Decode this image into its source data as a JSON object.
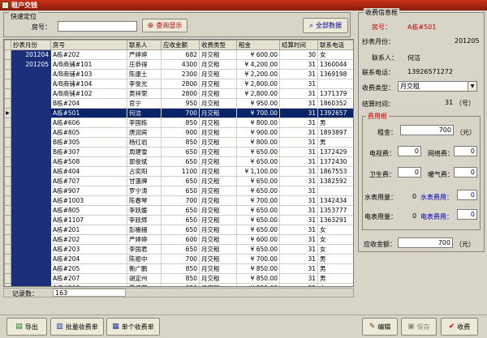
{
  "window": {
    "title": "租户交钱"
  },
  "quick_search": {
    "legend": "快速定位",
    "room_label": "房号：",
    "room_value": "",
    "query_button": "查询显示",
    "all_button": "全部数据"
  },
  "table": {
    "columns": [
      "抄表月份",
      "房号",
      "联系人",
      "应收金额",
      "收费类型",
      "租金",
      "结算时间",
      "联系电话"
    ],
    "month_1": "201204",
    "month_2": "201205",
    "rows": [
      {
        "room": "A栋#202",
        "contact": "严婷婷",
        "amount": "682",
        "type": "月交租",
        "rent": "¥ 600.00",
        "settle": "30",
        "phone": "女"
      },
      {
        "room": "A/B商铺#101",
        "contact": "庄恭得",
        "amount": "4300",
        "type": "月交租",
        "rent": "¥ 4,200.00",
        "settle": "31",
        "phone": "1360044"
      },
      {
        "room": "A/B商铺#103",
        "contact": "陈康土",
        "amount": "2300",
        "type": "月交租",
        "rent": "¥ 2,200.00",
        "settle": "31",
        "phone": "1369198"
      },
      {
        "room": "A/B商铺#104",
        "contact": "李俊光",
        "amount": "2800",
        "type": "月交租",
        "rent": "¥ 2,800.00",
        "settle": "31",
        "phone": ""
      },
      {
        "room": "A/B商铺#102",
        "contact": "黄祥荣",
        "amount": "2800",
        "type": "月交租",
        "rent": "¥ 2,800.00",
        "settle": "31",
        "phone": "1371379"
      },
      {
        "room": "B栋#204",
        "contact": "官宁",
        "amount": "950",
        "type": "月交租",
        "rent": "¥ 950.00",
        "settle": "31",
        "phone": "1860352"
      },
      {
        "room": "A栋#501",
        "contact": "何洁",
        "amount": "700",
        "type": "月交租",
        "rent": "¥ 700.00",
        "settle": "31",
        "phone": "1392657"
      },
      {
        "room": "A栋#606",
        "contact": "李国栋",
        "amount": "850",
        "type": "月交租",
        "rent": "¥ 800.00",
        "settle": "31",
        "phone": "男"
      },
      {
        "room": "A栋#805",
        "contact": "唐润宾",
        "amount": "900",
        "type": "月交租",
        "rent": "¥ 900.00",
        "settle": "31",
        "phone": "1893897"
      },
      {
        "room": "B栋#305",
        "contact": "杨红岩",
        "amount": "850",
        "type": "月交租",
        "rent": "¥ 800.00",
        "settle": "31",
        "phone": "男"
      },
      {
        "room": "B栋#307",
        "contact": "周建雪",
        "amount": "650",
        "type": "月交租",
        "rent": "¥ 650.00",
        "settle": "31",
        "phone": "1372429"
      },
      {
        "room": "A栋#508",
        "contact": "郭俊斌",
        "amount": "650",
        "type": "月交租",
        "rent": "¥ 650.00",
        "settle": "31",
        "phone": "1372430"
      },
      {
        "room": "A栋#404",
        "contact": "占奕阳",
        "amount": "1100",
        "type": "月交租",
        "rent": "¥ 1,100.00",
        "settle": "31",
        "phone": "1867553"
      },
      {
        "room": "A栋#707",
        "contact": "甘蓬牌",
        "amount": "650",
        "type": "月交租",
        "rent": "¥ 650.00",
        "settle": "31",
        "phone": "1382592"
      },
      {
        "room": "A栋#907",
        "contact": "罗宁涛",
        "amount": "650",
        "type": "月交租",
        "rent": "¥ 650.00",
        "settle": "31",
        "phone": ""
      },
      {
        "room": "A栋#1003",
        "contact": "陈春琴",
        "amount": "700",
        "type": "月交租",
        "rent": "¥ 700.00",
        "settle": "31",
        "phone": "1342434"
      },
      {
        "room": "A栋#805",
        "contact": "李跃媛",
        "amount": "650",
        "type": "月交租",
        "rent": "¥ 650.00",
        "settle": "31",
        "phone": "1353777"
      },
      {
        "room": "A栋#1107",
        "contact": "李跃辉",
        "amount": "650",
        "type": "月交租",
        "rent": "¥ 650.00",
        "settle": "31",
        "phone": "1363291"
      },
      {
        "room": "A栋#201",
        "contact": "彭栅栅",
        "amount": "650",
        "type": "月交租",
        "rent": "¥ 650.00",
        "settle": "31",
        "phone": "女"
      },
      {
        "room": "A栋#202",
        "contact": "严婷婷",
        "amount": "600",
        "type": "月交租",
        "rent": "¥ 600.00",
        "settle": "31",
        "phone": "女"
      },
      {
        "room": "A栋#203",
        "contact": "李国君",
        "amount": "650",
        "type": "月交租",
        "rent": "¥ 650.00",
        "settle": "31",
        "phone": "女"
      },
      {
        "room": "A栋#204",
        "contact": "陈振中",
        "amount": "700",
        "type": "月交租",
        "rent": "¥ 700.00",
        "settle": "31",
        "phone": "男"
      },
      {
        "room": "A栋#205",
        "contact": "衡广鹏",
        "amount": "850",
        "type": "月交租",
        "rent": "¥ 850.00",
        "settle": "31",
        "phone": "男"
      },
      {
        "room": "A栋#207",
        "contact": "胡定州",
        "amount": "850",
        "type": "月交租",
        "rent": "¥ 850.00",
        "settle": "31",
        "phone": "男"
      },
      {
        "room": "A栋#208",
        "contact": "霍佳芳",
        "amount": "850",
        "type": "月交租",
        "rent": "¥ 850.00",
        "settle": "31",
        "phone": "女"
      }
    ],
    "record_label": "记录数：",
    "record_count": "163"
  },
  "buttons": {
    "export": "导出",
    "batch": "批量收费单",
    "single": "单个收费单",
    "edit": "编辑",
    "save": "保存",
    "collect": "收费"
  },
  "info": {
    "legend": "收费信息框",
    "room_label": "房号：",
    "room_value": "A栋#501",
    "month_label": "抄表月份：",
    "month_value": "201205",
    "contact_label": "联系人：",
    "contact_value": "何洁",
    "phone_label": "联系电话：",
    "phone_value": "13926571272",
    "type_label": "收费类型：",
    "type_value": "月交租",
    "settle_label": "结算时间：",
    "settle_value": "31",
    "settle_unit": "（号）",
    "fee_legend": "费用框",
    "rent_label": "租金：",
    "rent_value": "700",
    "yuan": "（元）",
    "tv_label": "电视费：",
    "tv_value": "0",
    "net_label": "网络费：",
    "net_value": "0",
    "sanit_label": "卫生费：",
    "sanit_value": "0",
    "heat_label": "暖气费：",
    "heat_value": "0",
    "water_use_label": "水表用量：",
    "water_use_value": "0",
    "water_fee_label": "水表费用：",
    "water_fee_value": "0",
    "elec_use_label": "电表用量：",
    "elec_use_value": "0",
    "elec_fee_label": "电表费用：",
    "elec_fee_value": "0",
    "total_label": "应收金额：",
    "total_value": "700",
    "total_unit": "（元）"
  }
}
